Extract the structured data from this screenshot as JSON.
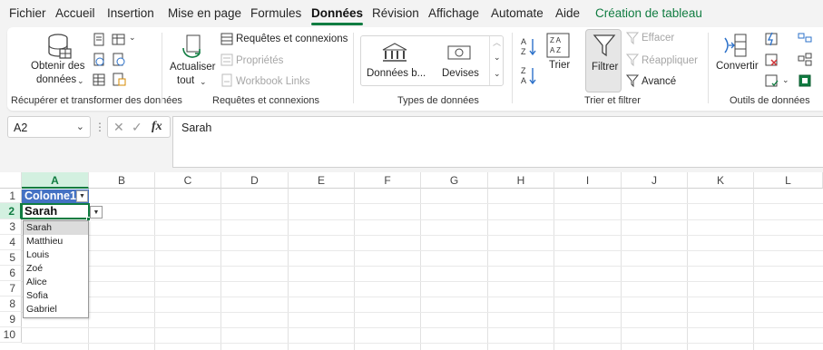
{
  "menu": {
    "tabs": [
      "Fichier",
      "Accueil",
      "Insertion",
      "Mise en page",
      "Formules",
      "Données",
      "Révision",
      "Affichage",
      "Automate",
      "Aide",
      "Création de tableau"
    ],
    "active": "Données"
  },
  "ribbon": {
    "get_data_line1": "Obtenir des",
    "get_data_line2": "données",
    "group1_label": "Récupérer et transformer des données",
    "refresh_line1": "Actualiser",
    "refresh_line2": "tout",
    "queries_connections": "Requêtes et connexions",
    "properties": "Propriétés",
    "workbook_links": "Workbook Links",
    "group2_label": "Requêtes et connexions",
    "stocks": "Données b...",
    "currencies": "Devises",
    "group3_label": "Types de données",
    "sort": "Trier",
    "filter": "Filtrer",
    "clear": "Effacer",
    "reapply": "Réappliquer",
    "advanced": "Avancé",
    "group4_label": "Trier et filtrer",
    "convert": "Convertir",
    "group5_label": "Outils de données"
  },
  "formula_bar": {
    "name_box": "A2",
    "content": "Sarah",
    "fx": "fx"
  },
  "grid": {
    "columns": [
      "A",
      "B",
      "C",
      "D",
      "E",
      "F",
      "G",
      "H",
      "I",
      "J",
      "K",
      "L"
    ],
    "rows": [
      "1",
      "2",
      "3",
      "4",
      "5",
      "6",
      "7",
      "8",
      "9",
      "10"
    ],
    "a1": "Colonne1",
    "a2": "Sarah",
    "dropdown_items": [
      "Sarah",
      "Matthieu",
      "Louis",
      "Zoé",
      "Alice",
      "Sofia",
      "Gabriel"
    ],
    "highlighted_item": "Sarah"
  },
  "colors": {
    "accent": "#107c41",
    "table_header": "#4472c4"
  }
}
